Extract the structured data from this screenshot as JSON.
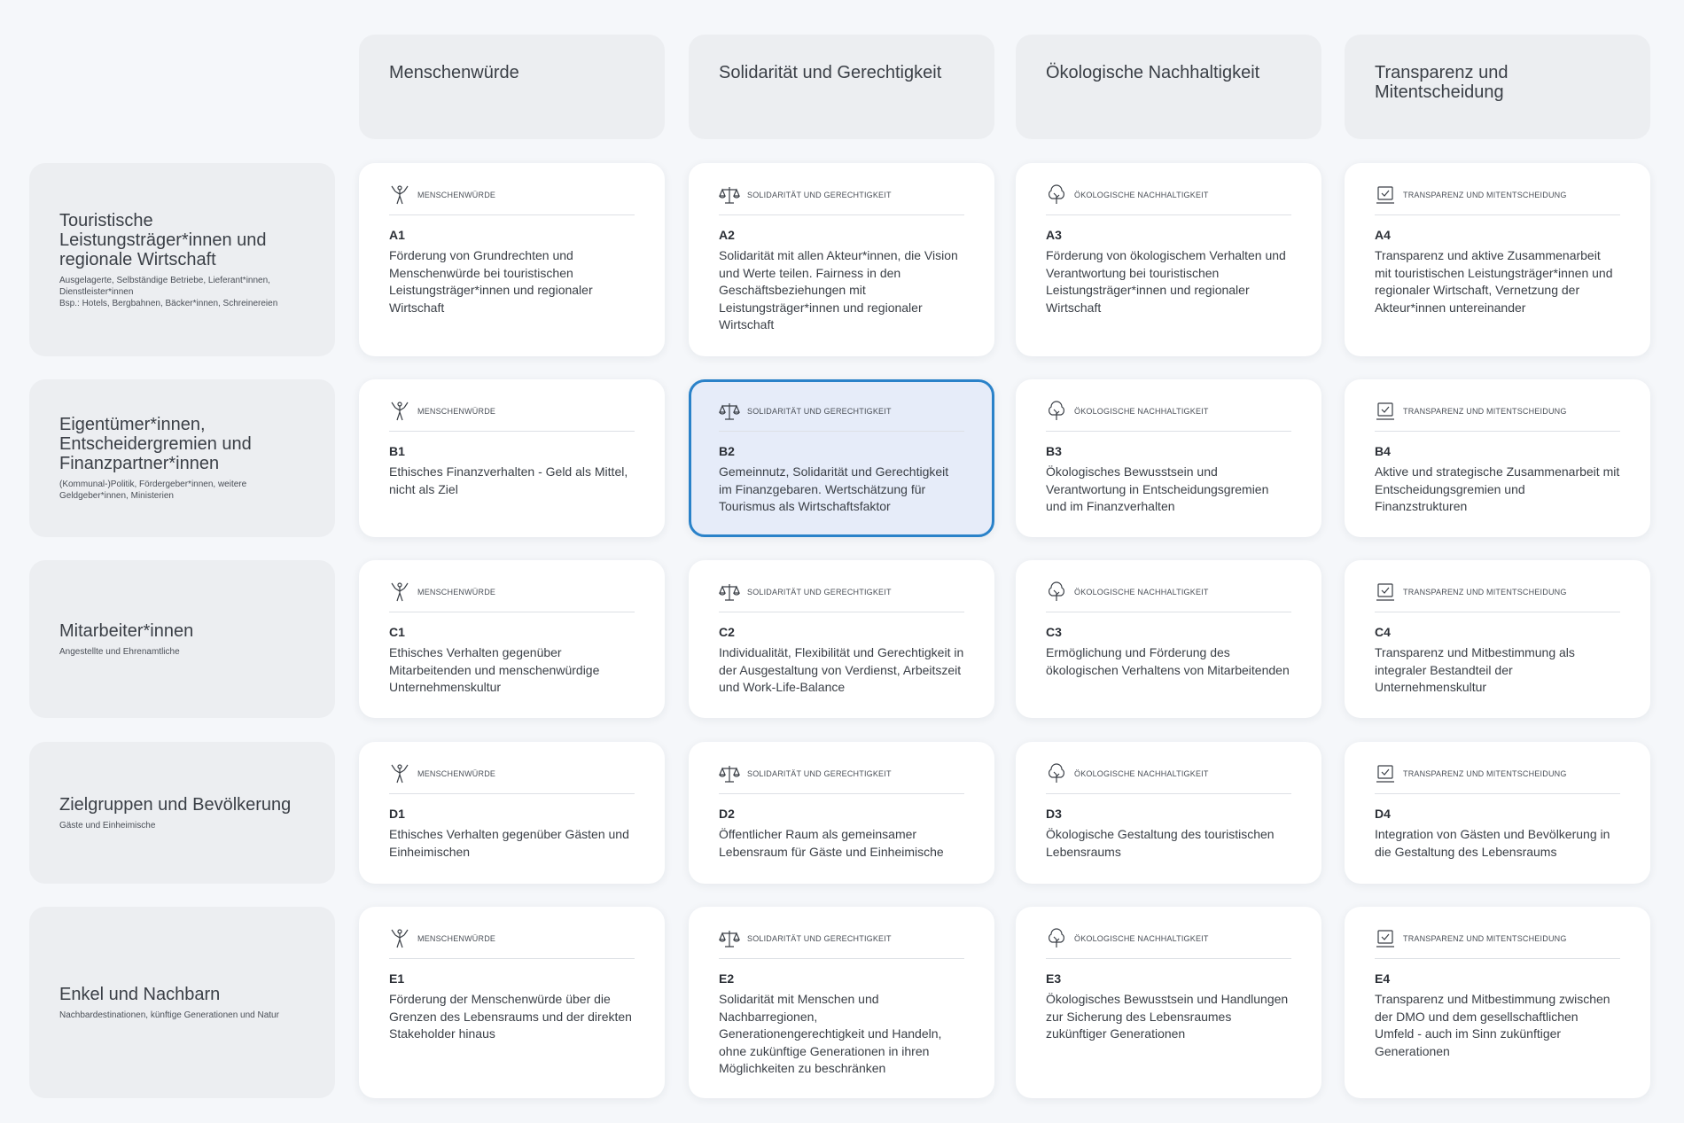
{
  "columns": [
    {
      "title": "Menschenwürde",
      "icon": "person-icon"
    },
    {
      "title": "Solidarität und Gerechtigkeit",
      "icon": "scales-icon"
    },
    {
      "title": "Ökologische Nachhaltigkeit",
      "icon": "tree-icon"
    },
    {
      "title": "Transparenz und Mitentscheidung",
      "icon": "checkbox-icon"
    }
  ],
  "column_labels": [
    "Menschenwürde",
    "Solidarität und Gerechtigkeit",
    "Ökologische Nachhaltigkeit",
    "Transparenz und Mitentscheidung"
  ],
  "rows": [
    {
      "title": "Touristische Leistungsträger*innen und regionale Wirtschaft",
      "subtitle": "Ausgelagerte, Selbständige Betriebe, Lieferant*innen, Dienstleister*innen\nBsp.: Hotels, Bergbahnen, Bäcker*innen, Schreinereien",
      "cells": [
        {
          "code": "A1",
          "desc": "Förderung von Grundrechten und Menschenwürde bei touristischen Leistungsträger*innen und regionaler Wirtschaft"
        },
        {
          "code": "A2",
          "desc": "Solidarität mit allen Akteur*innen, die Vision und Werte teilen. Fairness in den Geschäftsbeziehungen mit Leistungsträger*innen und regionaler Wirtschaft"
        },
        {
          "code": "A3",
          "desc": "Förderung von ökologischem Verhalten und Verantwortung bei touristischen Leistungsträger*innen und regionaler Wirtschaft"
        },
        {
          "code": "A4",
          "desc": "Transparenz und aktive Zusammenarbeit mit touristischen Leistungsträger*innen und regionaler Wirtschaft, Vernetzung der Akteur*innen untereinander"
        }
      ]
    },
    {
      "title": "Eigentümer*innen, Entscheidergremien und Finanzpartner*innen",
      "subtitle": "(Kommunal-)Politik, Fördergeber*innen, weitere Geldgeber*innen, Ministerien",
      "cells": [
        {
          "code": "B1",
          "desc": "Ethisches Finanzverhalten - Geld als Mittel, nicht als Ziel"
        },
        {
          "code": "B2",
          "desc": "Gemeinnutz, Solidarität und Gerechtigkeit im Finanzgebaren. Wertschätzung für Tourismus als Wirtschaftsfaktor"
        },
        {
          "code": "B3",
          "desc": "Ökologisches Bewusstsein und Verantwortung in Entscheidungsgremien und im Finanzverhalten"
        },
        {
          "code": "B4",
          "desc": "Aktive und strategische Zusammenarbeit mit Entscheidungsgremien und Finanzstrukturen"
        }
      ]
    },
    {
      "title": "Mitarbeiter*innen",
      "subtitle": "Angestellte und Ehrenamtliche",
      "cells": [
        {
          "code": "C1",
          "desc": "Ethisches Verhalten gegenüber Mitarbeitenden und menschenwürdige Unternehmenskultur"
        },
        {
          "code": "C2",
          "desc": "Individualität, Flexibilität und Gerechtigkeit in der Ausgestaltung von Verdienst, Arbeitszeit und Work-Life-Balance"
        },
        {
          "code": "C3",
          "desc": "Ermöglichung und Förderung des ökologischen Verhaltens von Mitarbeitenden"
        },
        {
          "code": "C4",
          "desc": "Transparenz und Mitbestimmung als integraler Bestandteil der Unternehmenskultur"
        }
      ]
    },
    {
      "title": "Zielgruppen und Bevölkerung",
      "subtitle": "Gäste und Einheimische",
      "cells": [
        {
          "code": "D1",
          "desc": "Ethisches Verhalten gegenüber Gästen und Einheimischen"
        },
        {
          "code": "D2",
          "desc": "Öffentlicher Raum als gemeinsamer Lebensraum für Gäste und Einheimische"
        },
        {
          "code": "D3",
          "desc": "Ökologische Gestaltung des touristischen Lebensraums"
        },
        {
          "code": "D4",
          "desc": "Integration von Gästen und Bevölkerung in die Gestaltung des Lebensraums"
        }
      ]
    },
    {
      "title": "Enkel und Nachbarn",
      "subtitle": "Nachbardestinationen, künftige Generationen und Natur",
      "cells": [
        {
          "code": "E1",
          "desc": "Förderung der Menschenwürde über die Grenzen des Lebensraums und der direkten Stakeholder hinaus"
        },
        {
          "code": "E2",
          "desc": "Solidarität mit Menschen und Nachbarregionen, Generationengerechtigkeit und Handeln, ohne zukünftige Generationen in ihren Möglichkeiten zu beschränken"
        },
        {
          "code": "E3",
          "desc": "Ökologisches Bewusstsein und Handlungen zur Sicherung des Lebensraumes zukünftiger Generationen"
        },
        {
          "code": "E4",
          "desc": "Transparenz und Mitbestimmung zwischen der DMO und dem gesellschaftlichen Umfeld - auch im Sinn zukünftiger Generationen"
        }
      ]
    }
  ],
  "selected_cell": "B2",
  "colors": {
    "accent": "#2a82c9",
    "selected_bg": "#e6ecf9",
    "header_bg": "#eceef1",
    "card_bg": "#ffffff",
    "page_bg": "#f5f7fa"
  }
}
